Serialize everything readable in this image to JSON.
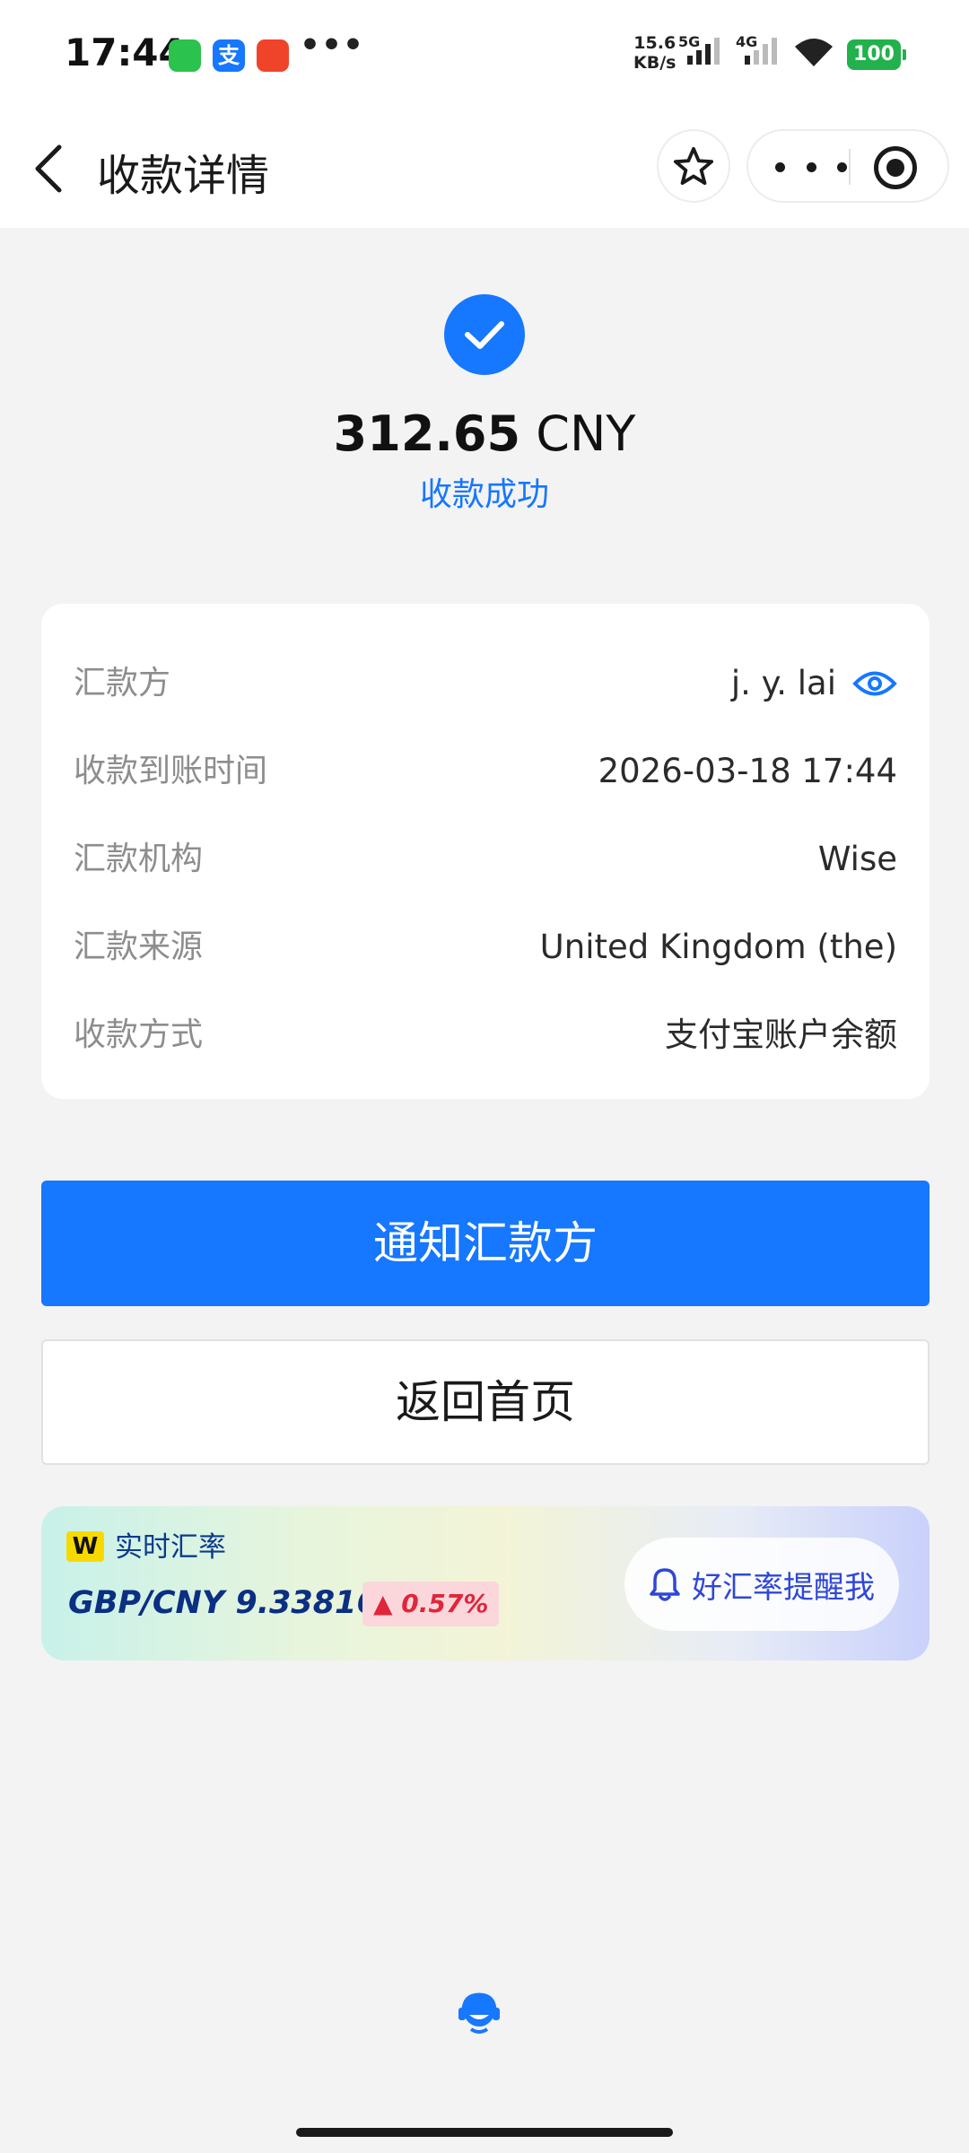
{
  "status_bar": {
    "time": "17:44",
    "net_speed_value": "15.6",
    "net_speed_unit": "KB/s",
    "network_1": "5G",
    "network_2": "4G",
    "battery": "100",
    "alipay_glyph": "支",
    "overflow": "•••"
  },
  "nav": {
    "title": "收款详情",
    "icons": [
      "back-arrow-icon",
      "star-icon",
      "more-icon",
      "close-miniapp-icon"
    ]
  },
  "result": {
    "amount": "312.65",
    "currency": "CNY",
    "status": "收款成功",
    "icon": "check-icon"
  },
  "details": [
    {
      "key": "remitter",
      "label": "汇款方",
      "value": "j. y. lai"
    },
    {
      "key": "arrival_time",
      "label": "收款到账时间",
      "value": "2026-03-18 17:44"
    },
    {
      "key": "institution",
      "label": "汇款机构",
      "value": "Wise"
    },
    {
      "key": "source",
      "label": "汇款来源",
      "value": "United Kingdom (the)"
    },
    {
      "key": "method",
      "label": "收款方式",
      "value": "支付宝账户余额"
    }
  ],
  "actions": {
    "notify_label": "通知汇款方",
    "home_label": "返回首页"
  },
  "rate_banner": {
    "logo_text": "W",
    "title": "实时汇率",
    "pair_rate": "GBP/CNY 9.338167",
    "change": "▲ 0.57%",
    "alert_label": "好汇率提醒我"
  },
  "colors": {
    "primary": "#1677ff",
    "success_text": "#1677ff",
    "change_up": "#e0263a",
    "background": "#f3f3f3"
  }
}
